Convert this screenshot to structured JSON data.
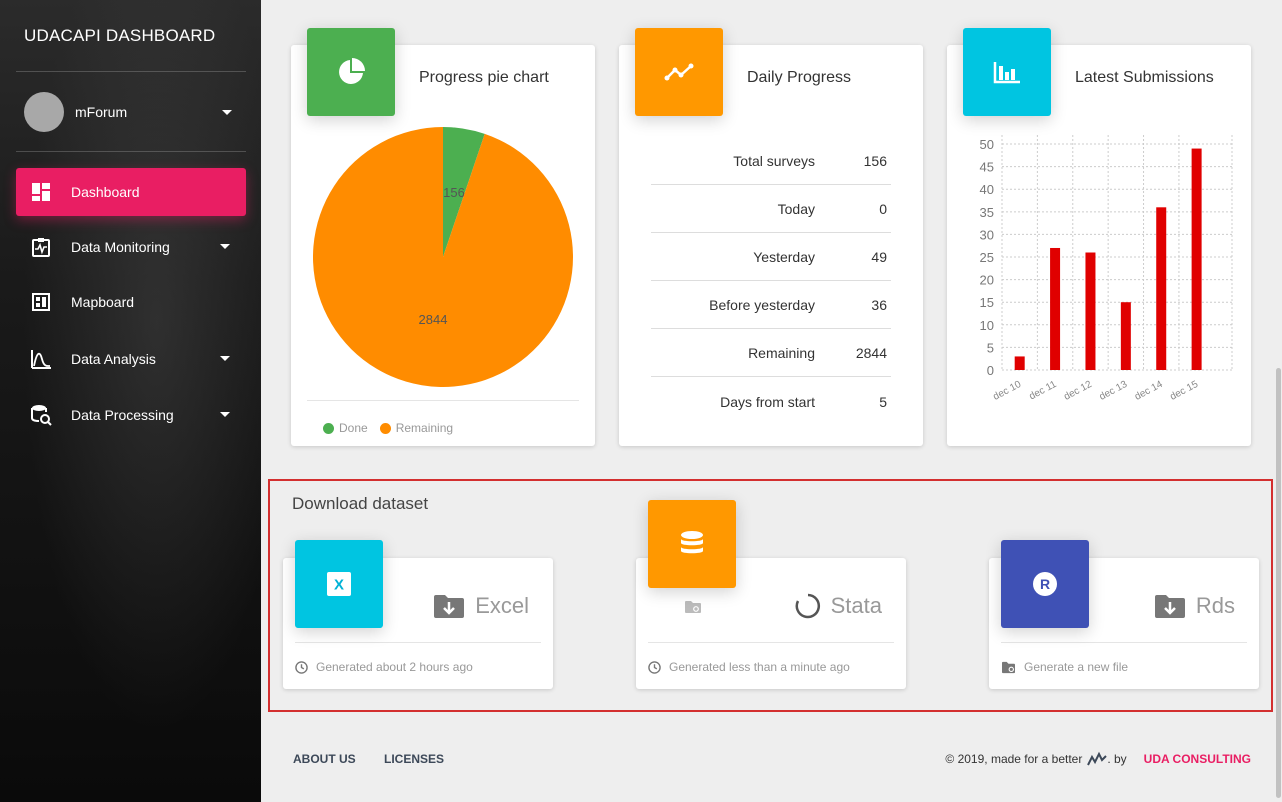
{
  "sidebar": {
    "brand": "UDACAPI DASHBOARD",
    "user_name": "mForum",
    "items": [
      {
        "label": "Dashboard",
        "icon": "dashboard-icon",
        "active": true
      },
      {
        "label": "Data Monitoring",
        "icon": "monitoring-icon"
      },
      {
        "label": "Mapboard",
        "icon": "mapboard-icon"
      },
      {
        "label": "Data Analysis",
        "icon": "analysis-icon"
      },
      {
        "label": "Data Processing",
        "icon": "processing-icon"
      }
    ]
  },
  "pie_card": {
    "title": "Progress pie chart",
    "legend": [
      "Done",
      "Remaining"
    ]
  },
  "progress_card": {
    "title": "Daily Progress",
    "rows": [
      {
        "label": "Total surveys",
        "value": "156"
      },
      {
        "label": "Today",
        "value": "0"
      },
      {
        "label": "Yesterday",
        "value": "49"
      },
      {
        "label": "Before yesterday",
        "value": "36"
      },
      {
        "label": "Remaining",
        "value": "2844"
      },
      {
        "label": "Days from start",
        "value": "5"
      }
    ]
  },
  "submissions_card": {
    "title": "Latest Submissions"
  },
  "chart_data": [
    {
      "type": "pie",
      "labels": [
        "Done",
        "Remaining"
      ],
      "values": [
        156,
        2844
      ],
      "colors": [
        "#4caf50",
        "#ff8c00"
      ]
    },
    {
      "type": "bar",
      "categories": [
        "dec 10",
        "dec 11",
        "dec 12",
        "dec 13",
        "dec 14",
        "dec 15"
      ],
      "values": [
        3,
        27,
        26,
        15,
        36,
        49
      ],
      "yticks": [
        0,
        5,
        10,
        15,
        20,
        25,
        30,
        35,
        40,
        45,
        50
      ],
      "ylim": [
        0,
        52
      ],
      "grid": true,
      "color": "#e00000"
    }
  ],
  "download": {
    "title": "Download dataset",
    "items": [
      {
        "label": "Excel",
        "status": "Generated about 2 hours ago",
        "icon": "excel-icon"
      },
      {
        "label": "Stata",
        "status": "Generated less than a minute ago",
        "icon": "database-icon"
      },
      {
        "label": "Rds",
        "status": "Generate a new file",
        "icon": "r-icon"
      }
    ]
  },
  "footer": {
    "about": "ABOUT US",
    "licenses": "LICENSES",
    "copyright": "© 2019, made for a better",
    "by": ". by",
    "company": "UDA CONSULTING"
  },
  "colors": {
    "accent": "#e91e63",
    "green": "#4caf50",
    "orange": "#ff9800",
    "cyan": "#00c5e1",
    "blue": "#3f51b5",
    "bar": "#e00000"
  }
}
